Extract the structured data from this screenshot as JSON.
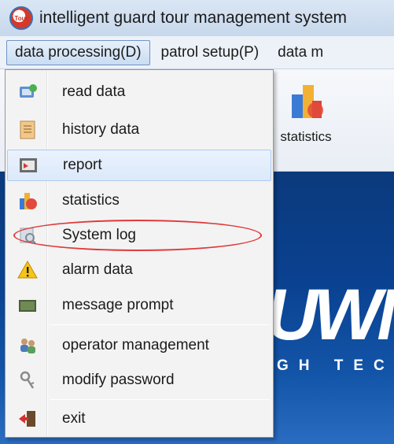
{
  "window": {
    "title": "intelligent guard tour management system",
    "app_icon_text": "Tour"
  },
  "menubar": {
    "items": [
      {
        "label": "data processing(D)",
        "active": true
      },
      {
        "label": "patrol setup(P)"
      },
      {
        "label": "data m"
      }
    ]
  },
  "toolbar": {
    "statistics_label": "statistics"
  },
  "banner": {
    "logo_text": "UWM",
    "subtitle": "GH TEC"
  },
  "dropdown": {
    "items": [
      {
        "label": "read data",
        "icon": "read-data-icon"
      },
      {
        "label": "history data",
        "icon": "history-data-icon"
      },
      {
        "label": "report",
        "icon": "report-icon",
        "selected": true
      },
      {
        "label": "statistics",
        "icon": "statistics-icon"
      },
      {
        "label": "System log",
        "icon": "system-log-icon"
      },
      {
        "label": "alarm data",
        "icon": "alarm-icon"
      },
      {
        "label": "message prompt",
        "icon": "message-prompt-icon"
      },
      {
        "label": "operator management",
        "icon": "operator-icon"
      },
      {
        "label": "modify password",
        "icon": "key-icon"
      },
      {
        "label": "exit",
        "icon": "exit-icon"
      }
    ]
  },
  "colors": {
    "highlight_ellipse": "#e13a3a",
    "banner_blue": "#0a4190"
  }
}
